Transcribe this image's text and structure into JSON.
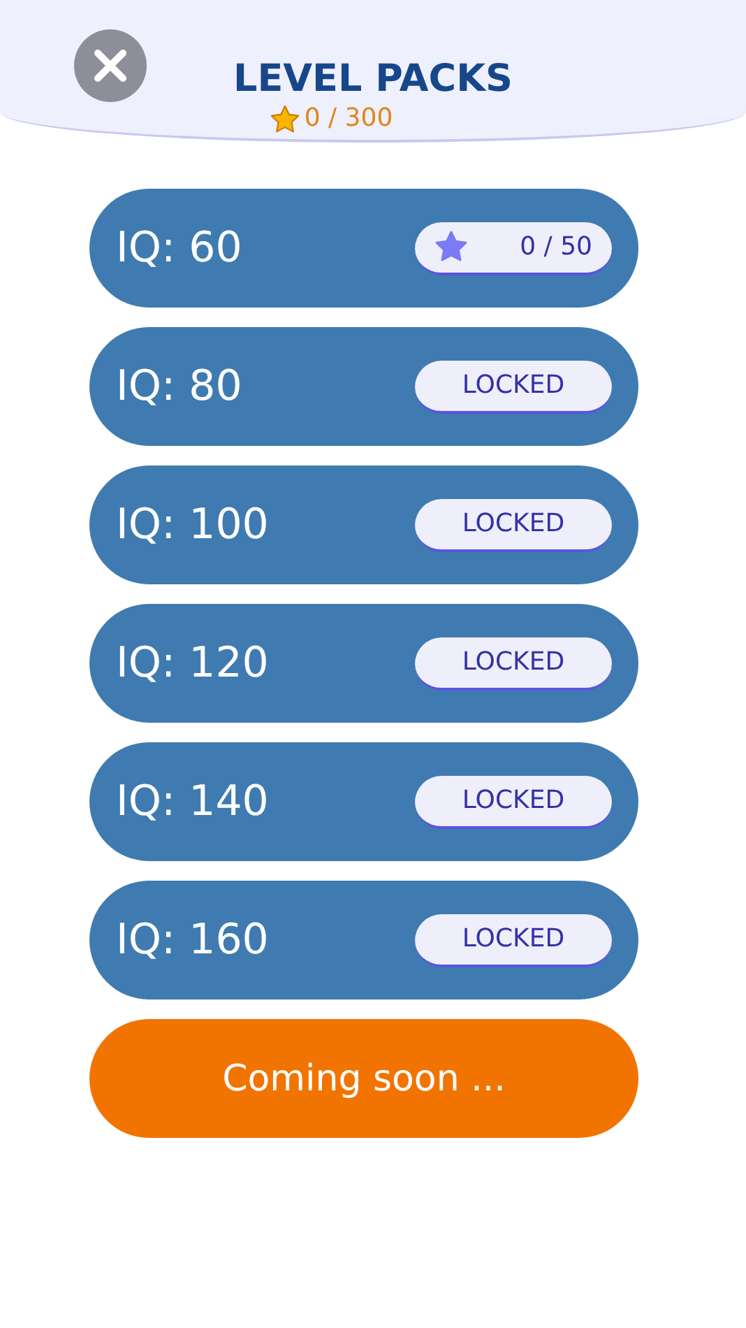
{
  "header": {
    "title": "LEVEL PACKS",
    "stars": "0 / 300"
  },
  "packs": [
    {
      "label": "IQ: 60",
      "kind": "progress",
      "badge": "0 / 50"
    },
    {
      "label": "IQ: 80",
      "kind": "locked",
      "badge": "LOCKED"
    },
    {
      "label": "IQ: 100",
      "kind": "locked",
      "badge": "LOCKED"
    },
    {
      "label": "IQ: 120",
      "kind": "locked",
      "badge": "LOCKED"
    },
    {
      "label": "IQ: 140",
      "kind": "locked",
      "badge": "LOCKED"
    },
    {
      "label": "IQ: 160",
      "kind": "locked",
      "badge": "LOCKED"
    }
  ],
  "coming_soon": "Coming soon ..."
}
